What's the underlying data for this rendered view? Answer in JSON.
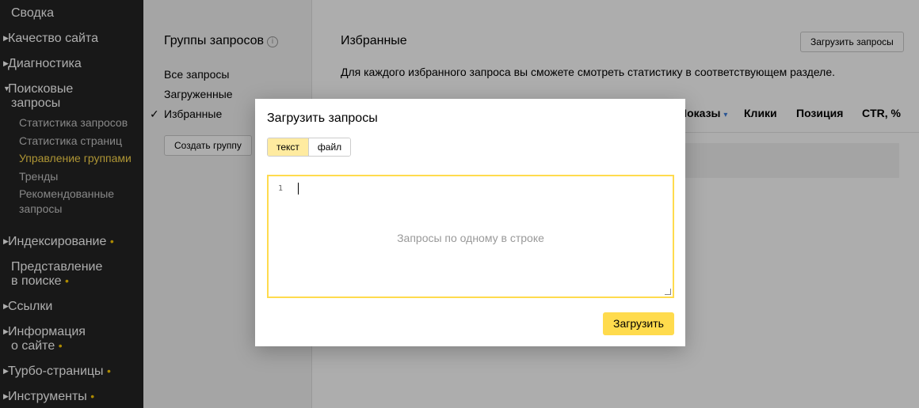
{
  "nav": {
    "items": [
      {
        "label": "Сводка"
      },
      {
        "label": "Качество сайта"
      },
      {
        "label": "Диагностика"
      },
      {
        "label": "Поисковые запросы"
      },
      {
        "label": "Индексирование"
      },
      {
        "label": "Представление в поиске"
      },
      {
        "label": "Ссылки"
      },
      {
        "label": "Информация о сайте"
      },
      {
        "label": "Турбо-страницы"
      },
      {
        "label": "Инструменты"
      }
    ],
    "search_line1": "Поисковые",
    "search_line2": "запросы",
    "repr_line1": "Представление",
    "repr_line2": "в поиске",
    "info_line1": "Информация",
    "info_line2": "о сайте",
    "sub_items": [
      {
        "label": "Статистика запросов"
      },
      {
        "label": "Статистика страниц"
      },
      {
        "label": "Управление группами"
      },
      {
        "label": "Тренды"
      },
      {
        "label": "Рекомендованные"
      },
      {
        "label": "запросы"
      }
    ],
    "dot": "•",
    "accent_color": "#ffdb4d"
  },
  "groups": {
    "title": "Группы запросов",
    "info_icon": "i",
    "links": [
      {
        "label": "Все запросы"
      },
      {
        "label": "Загруженные"
      },
      {
        "label": "Избранные"
      }
    ],
    "checkmark": "✓",
    "create_button": "Создать группу"
  },
  "main": {
    "title": "Избранные",
    "load_button": "Загрузить запросы",
    "description": "Для каждого избранного запроса вы сможете смотреть статистику в соответствующем разделе.",
    "columns": [
      "Показы",
      "Клики",
      "Позиция",
      "CTR, %"
    ],
    "sort_caret": "▾"
  },
  "modal": {
    "title": "Загрузить запросы",
    "tabs": [
      {
        "label": "текст"
      },
      {
        "label": "файл"
      }
    ],
    "line_number": "1",
    "placeholder": "Запросы по одному в строке",
    "submit": "Загрузить"
  }
}
